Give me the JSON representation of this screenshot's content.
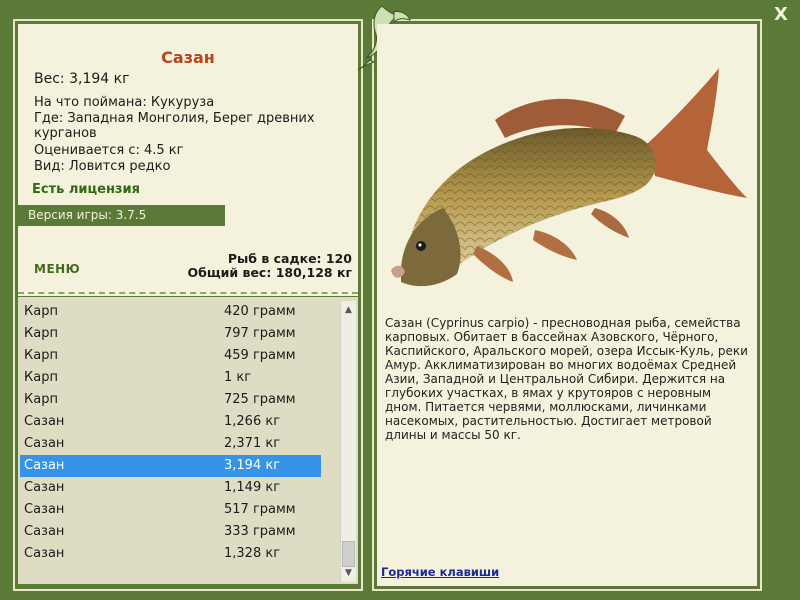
{
  "window": {
    "close_label": "X"
  },
  "info": {
    "title": "Сазан",
    "weight": "Вес: 3,194 кг",
    "caught_with": "На что поймана: Кукуруза",
    "location": "Где: Западная Монголия, Берег древних курганов",
    "valued_from": "Оценивается с: 4.5 кг",
    "kind": "Вид: Ловится редко",
    "license": "Есть лицензия",
    "version": "Версия игры: 3.7.5",
    "menu_label": "МЕНЮ",
    "cage_count": "Рыб в садке: 120",
    "total_weight": "Общий вес: 180,128 кг"
  },
  "fish_list": [
    {
      "name": "Карп",
      "weight": "420 грамм"
    },
    {
      "name": "Карп",
      "weight": "797 грамм"
    },
    {
      "name": "Карп",
      "weight": "459 грамм"
    },
    {
      "name": "Карп",
      "weight": "1 кг"
    },
    {
      "name": "Карп",
      "weight": "725 грамм"
    },
    {
      "name": "Сазан",
      "weight": "1,266 кг"
    },
    {
      "name": "Сазан",
      "weight": "2,371 кг"
    },
    {
      "name": "Сазан",
      "weight": "3,194 кг",
      "selected": true
    },
    {
      "name": "Сазан",
      "weight": "1,149 кг"
    },
    {
      "name": "Сазан",
      "weight": "517 грамм"
    },
    {
      "name": "Сазан",
      "weight": "333 грамм"
    },
    {
      "name": "Сазан",
      "weight": "1,328 кг"
    }
  ],
  "description": "Сазан (Cyprinus carpio) - пресноводная рыба, семейства карповых. Обитает в бассейнах Азовского, Чёрного, Каспийского, Аральского морей, озера Иссык-Куль, реки Амур. Акклиматизирован во многих водоёмах Средней Азии, Западной и Центральной Сибири. Держится на глубоких участках, в ямах у крутояров с неровным дном. Питается червями, моллюсками, личинками насекомых, растительностью. Достигает метровой длины и массы 50 кг.",
  "hotkeys_label": "Горячие клавиши",
  "colors": {
    "frame": "#5b7a37",
    "panel": "#f4f2dc",
    "list_bg": "#dedcc3",
    "selection": "#3593e8",
    "title": "#b8431c",
    "license": "#2e6a14"
  },
  "icons": {
    "close": "close-icon",
    "emblem": "fish-emblem-icon",
    "scroll_up": "arrow-up-icon",
    "scroll_down": "arrow-down-icon"
  }
}
